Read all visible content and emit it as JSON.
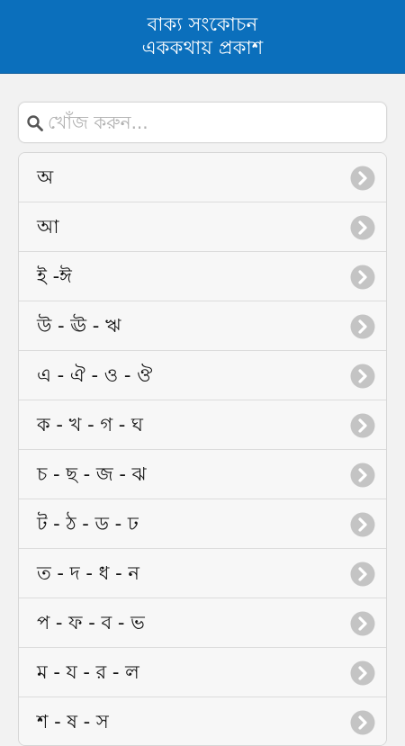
{
  "header": {
    "title_line1": "বাক্য সংকোচন",
    "title_line2": "এককথায় প্রকাশ"
  },
  "search": {
    "placeholder": "খোঁজ করুন...",
    "value": ""
  },
  "list": {
    "items": [
      {
        "label": "অ"
      },
      {
        "label": "আ"
      },
      {
        "label": "ই -ঈ"
      },
      {
        "label": "উ - ঊ - ঋ"
      },
      {
        "label": "এ - ঐ - ও - ঔ"
      },
      {
        "label": "ক - খ - গ - ঘ"
      },
      {
        "label": "চ - ছ - জ - ঝ"
      },
      {
        "label": "ট - ঠ - ড - ঢ"
      },
      {
        "label": "ত - দ - ধ - ন"
      },
      {
        "label": "প - ফ - ব - ভ"
      },
      {
        "label": "ম - য - র - ল"
      },
      {
        "label": "শ - ষ - স"
      }
    ]
  },
  "colors": {
    "header_bg": "#0b6fbc",
    "chevron_bg": "#c4c4c4"
  }
}
